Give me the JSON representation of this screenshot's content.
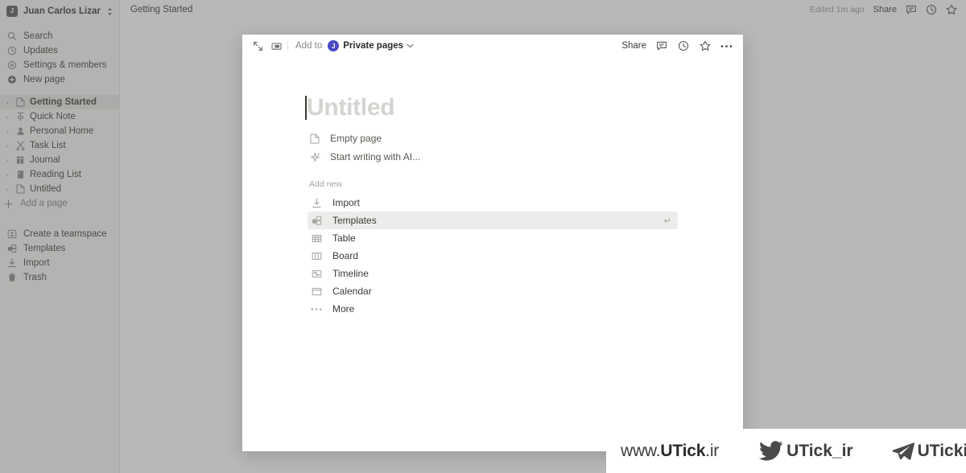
{
  "app": {
    "sidebar": {
      "workspace": {
        "avatar_initial": "J",
        "name": "Juan Carlos Lizar...",
        "chevron": "⌃⌄"
      },
      "nav_items": [
        {
          "label": "Search",
          "icon": "search-icon"
        },
        {
          "label": "Updates",
          "icon": "clock-icon"
        },
        {
          "label": "Settings & members",
          "icon": "gear-icon"
        },
        {
          "label": "New page",
          "icon": "new-page-icon"
        }
      ],
      "tree_items": [
        {
          "label": "Getting Started",
          "icon": "page-icon",
          "selected": true
        },
        {
          "label": "Quick Note",
          "icon": "pin-icon",
          "selected": false
        },
        {
          "label": "Personal Home",
          "icon": "person-icon",
          "selected": false
        },
        {
          "label": "Task List",
          "icon": "scissors-icon",
          "selected": false
        },
        {
          "label": "Journal",
          "icon": "books-icon",
          "selected": false
        },
        {
          "label": "Reading List",
          "icon": "book-icon",
          "selected": false
        },
        {
          "label": "Untitled",
          "icon": "page-icon",
          "selected": false
        }
      ],
      "add_page_label": "Add a page",
      "footer_items": [
        {
          "label": "Create a teamspace",
          "icon": "teamspace-icon"
        },
        {
          "label": "Templates",
          "icon": "templates-icon"
        },
        {
          "label": "Import",
          "icon": "import-icon"
        },
        {
          "label": "Trash",
          "icon": "trash-icon"
        }
      ]
    },
    "topbar": {
      "breadcrumb": "Getting Started",
      "edited_status": "Edited 1m ago",
      "share_label": "Share",
      "icons": [
        "comment-icon",
        "clock-icon",
        "star-icon",
        "more-icon"
      ]
    }
  },
  "modal": {
    "header": {
      "expand_icon": "expand-icon",
      "panel_icon": "side-peek-icon",
      "add_to_label": "Add to",
      "space_avatar_initial": "J",
      "space_name": "Private pages",
      "space_chevron": "⌄",
      "share_label": "Share",
      "icons": [
        "comment-icon",
        "clock-icon",
        "star-icon",
        "more-icon"
      ]
    },
    "title_placeholder": "Untitled",
    "quick_options": [
      {
        "label": "Empty page",
        "icon": "page-icon"
      },
      {
        "label": "Start writing with AI...",
        "icon": "sparkle-icon"
      }
    ],
    "add_new_label": "Add new",
    "menu_items": [
      {
        "label": "Import",
        "icon": "import-icon",
        "active": false,
        "enter_hint": ""
      },
      {
        "label": "Templates",
        "icon": "templates-icon",
        "active": true,
        "enter_hint": "↵"
      },
      {
        "label": "Table",
        "icon": "table-icon",
        "active": false,
        "enter_hint": ""
      },
      {
        "label": "Board",
        "icon": "board-icon",
        "active": false,
        "enter_hint": ""
      },
      {
        "label": "Timeline",
        "icon": "timeline-icon",
        "active": false,
        "enter_hint": ""
      },
      {
        "label": "Calendar",
        "icon": "calendar-icon",
        "active": false,
        "enter_hint": ""
      },
      {
        "label": "More",
        "icon": "more-icon",
        "active": false,
        "enter_hint": ""
      }
    ]
  },
  "watermark": {
    "url_prefix": "www.",
    "url_brand": "UTick",
    "url_suffix": ".ir",
    "twitter_handle": "UTick_ir",
    "telegram_handle": "UTickir"
  },
  "colors": {
    "accent_purple": "#4a49c9",
    "sidebar_bg": "#f7f7f5",
    "overlay": "#5a5a5a",
    "highlight_row": "#ececea"
  }
}
